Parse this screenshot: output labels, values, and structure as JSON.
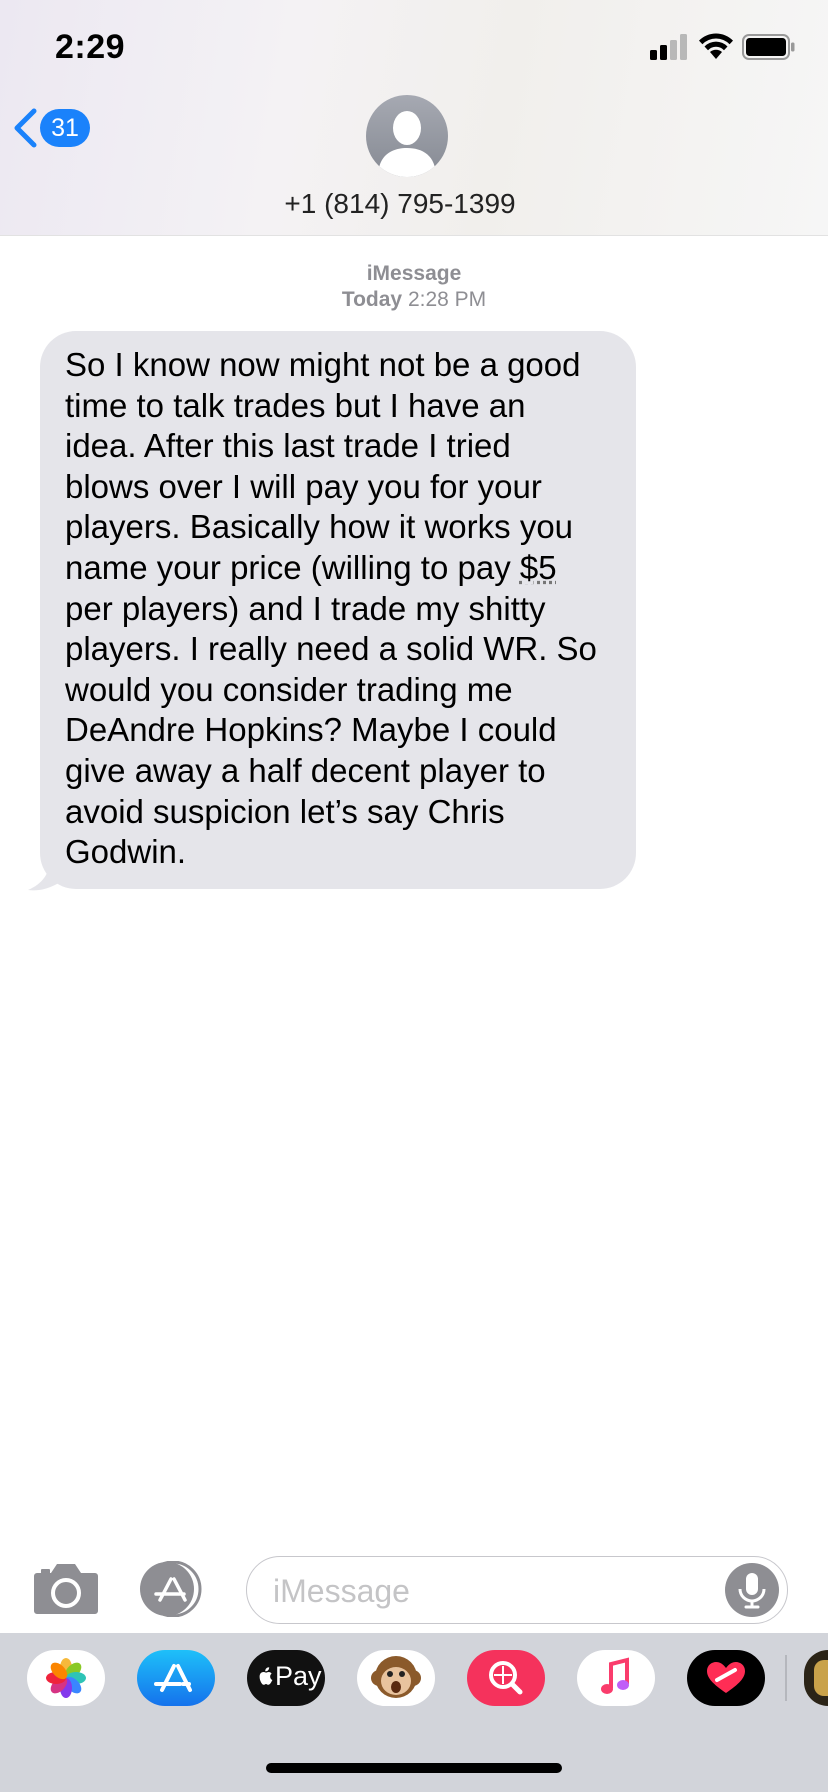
{
  "status_bar": {
    "time": "2:29",
    "icons": [
      "cellular-signal-icon",
      "wifi-icon",
      "battery-icon"
    ]
  },
  "header": {
    "back_count": "31",
    "contact": "+1 (814) 795-1399",
    "avatar_icon": "person-silhouette-icon"
  },
  "conversation": {
    "service": "iMessage",
    "date_label": "Today",
    "time_label": "2:28 PM",
    "messages": [
      {
        "direction": "incoming",
        "lines": [
          "So I know now might not be a good",
          "time to talk trades but I have an",
          "idea. After this last trade I tried",
          "blows over I will pay you for your",
          "players. Basically how it works you",
          "name your price (willing to pay ",
          "$5",
          "per players) and I trade my shitty",
          "players. I really need a solid WR. So",
          "would you consider trading me",
          "DeAndre Hopkins? Maybe I could",
          "give away a half decent player to",
          "avoid suspicion let’s say Chris",
          "Godwin."
        ]
      }
    ]
  },
  "input_bar": {
    "placeholder": "iMessage",
    "icons": [
      "camera-icon",
      "app-store-icon",
      "microphone-icon"
    ]
  },
  "app_drawer": {
    "apps": [
      "photos-icon",
      "app-store-icon",
      "apple-pay-icon",
      "animoji-monkey-icon",
      "image-search-icon",
      "music-icon",
      "digital-touch-icon"
    ],
    "apple_pay_label": "Pay"
  },
  "colors": {
    "accent_blue": "#1a82fb",
    "incoming_bubble": "#e5e5ea",
    "meta_gray": "#8e8e93",
    "drawer_bg": "#d2d4da"
  }
}
